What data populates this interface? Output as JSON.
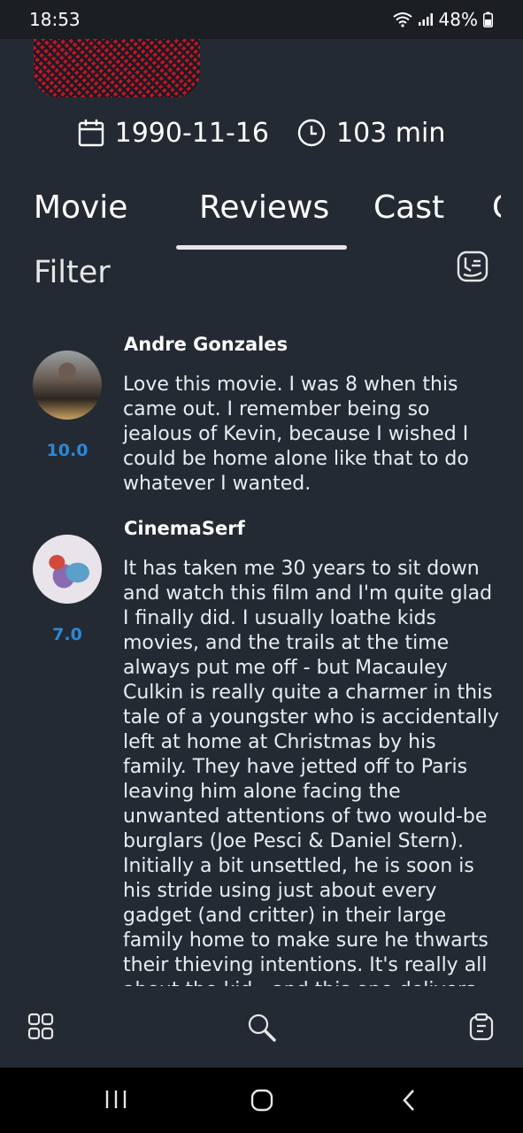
{
  "status_bar": {
    "time": "18:53",
    "battery": "48%"
  },
  "movie": {
    "release_date": "1990-11-16",
    "runtime": "103 min"
  },
  "tabs": [
    {
      "label": "About Movie",
      "active": false
    },
    {
      "label": "Reviews",
      "active": true
    },
    {
      "label": "Cast",
      "active": false
    },
    {
      "label": "C",
      "active": false
    }
  ],
  "filter": {
    "label": "Filter"
  },
  "reviews": [
    {
      "author": "Andre Gonzales",
      "rating": "10.0",
      "content": "Love this movie. I was 8 when this came out. I remember being so jealous of Kevin, because I wished I could be home alone like that to do whatever I wanted."
    },
    {
      "author": "CinemaSerf",
      "rating": "7.0",
      "content": "It has taken me 30 years to sit down and watch this film and I'm quite glad I finally did. I usually loathe kids movies, and the trails at the time always put me off - but Macauley Culkin is really quite a charmer in this tale of a youngster who is accidentally left at home at Christmas by his family. They have jetted off to Paris leaving him alone facing the unwanted attentions of two would-be burglars (Joe Pesci & Daniel Stern). Initially a bit unsettled, he is soon is his stride using just about every gadget (and critter) in their large family home to make sure he thwarts their thieving intentions. It's really all about the kid - and this one delivers"
    }
  ],
  "icons": {
    "calendar": "calendar-icon",
    "clock": "clock-icon",
    "filter": "filter-icon",
    "grid": "grid-icon",
    "search": "search-icon",
    "clipboard": "clipboard-icon"
  },
  "colors": {
    "background": "#242a33",
    "rating": "#2b88d8",
    "status_bar": "#1b1e22"
  }
}
